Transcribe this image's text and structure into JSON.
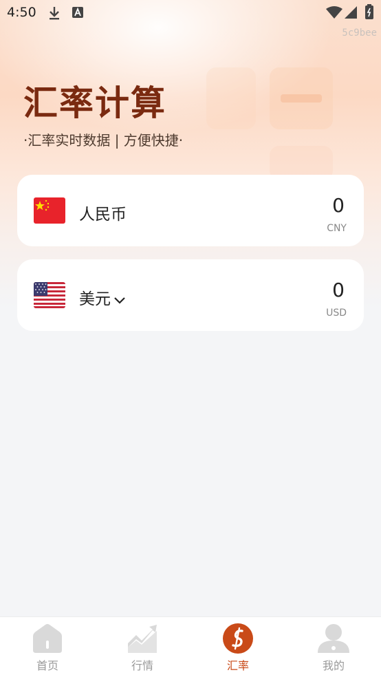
{
  "status_bar": {
    "time": "4:50",
    "overlay_id": "5c9bee",
    "icons": [
      "download-icon",
      "text-a-icon",
      "wifi-icon",
      "signal-icon",
      "battery-icon"
    ]
  },
  "header": {
    "title": "汇率计算",
    "subtitle": "·汇率实时数据 | 方便快捷·"
  },
  "converter": {
    "base": {
      "name": "人民币",
      "amount": "0",
      "code": "CNY",
      "flag": "china-flag-icon"
    },
    "target": {
      "name": "美元",
      "amount": "0",
      "code": "USD",
      "flag": "usa-flag-icon",
      "dropdown_icon": "chevron-down-icon"
    }
  },
  "tab_bar": {
    "tabs": [
      {
        "label": "首页",
        "icon": "home-icon",
        "active": false
      },
      {
        "label": "行情",
        "icon": "chart-trend-icon",
        "active": false
      },
      {
        "label": "汇率",
        "icon": "exchange-rate-icon",
        "active": true
      },
      {
        "label": "我的",
        "icon": "profile-icon",
        "active": false
      }
    ]
  },
  "colors": {
    "accent": "#c94a18",
    "title": "#7a2a10",
    "background": "#f4f5f7",
    "inactive_tab": "#d5d5d5"
  }
}
